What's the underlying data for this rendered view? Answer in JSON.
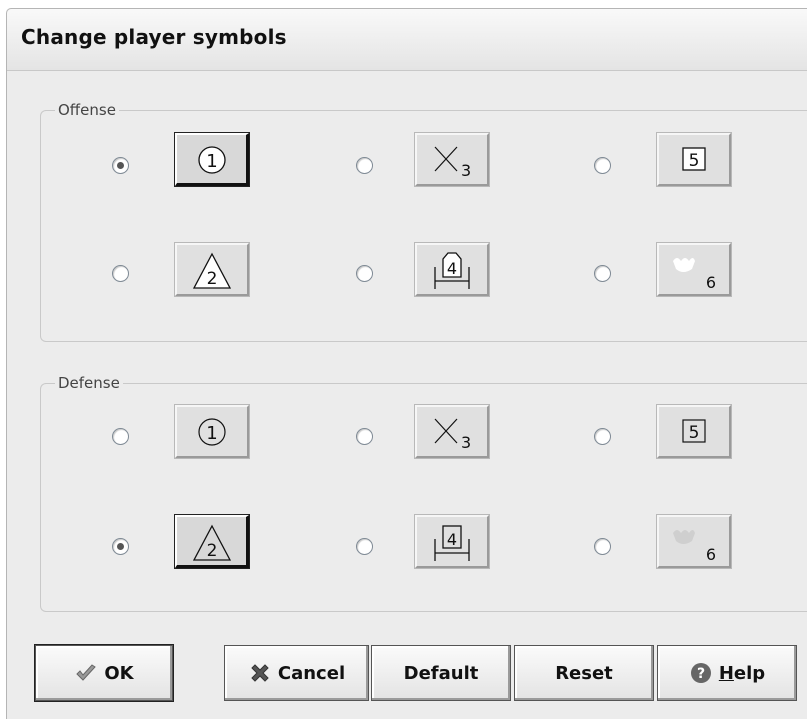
{
  "dialog": {
    "title": "Change player symbols"
  },
  "offense": {
    "label": "Offense",
    "options": [
      {
        "symbol": "circle-symbol",
        "number": "1",
        "checked": true
      },
      {
        "symbol": "cross-symbol",
        "number": "3",
        "checked": false
      },
      {
        "symbol": "square-symbol",
        "number": "5",
        "checked": false
      },
      {
        "symbol": "triangle-symbol",
        "number": "2",
        "checked": false
      },
      {
        "symbol": "house-symbol",
        "number": "4",
        "checked": false
      },
      {
        "symbol": "crown-symbol",
        "number": "6",
        "checked": false
      }
    ]
  },
  "defense": {
    "label": "Defense",
    "options": [
      {
        "symbol": "circle-symbol",
        "number": "1",
        "checked": false
      },
      {
        "symbol": "cross-symbol",
        "number": "3",
        "checked": false
      },
      {
        "symbol": "square-symbol",
        "number": "5",
        "checked": false
      },
      {
        "symbol": "triangle-symbol",
        "number": "2",
        "checked": true
      },
      {
        "symbol": "house-symbol",
        "number": "4",
        "checked": false
      },
      {
        "symbol": "crown-symbol",
        "number": "6",
        "checked": false
      }
    ]
  },
  "buttons": {
    "ok": "OK",
    "cancel": "Cancel",
    "default": "Default",
    "reset": "Reset",
    "help_prefix": "",
    "help_hotkey": "H",
    "help_rest": "elp"
  }
}
